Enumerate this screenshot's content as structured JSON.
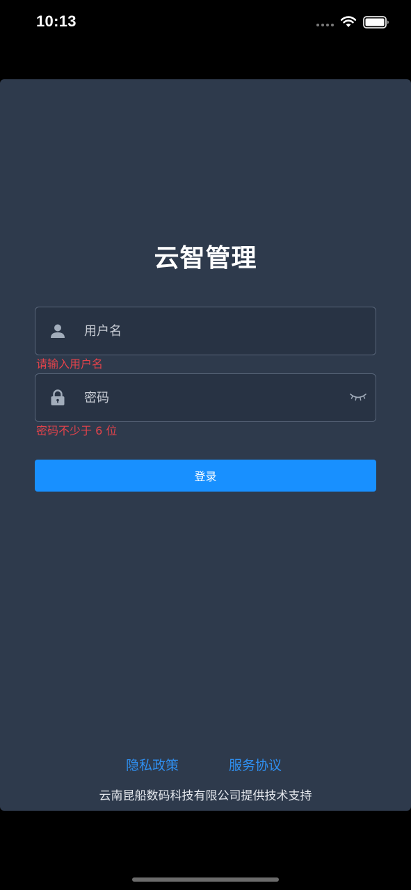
{
  "status_bar": {
    "time": "10:13"
  },
  "app": {
    "title": "云智管理"
  },
  "login_form": {
    "username": {
      "placeholder": "用户名",
      "value": "",
      "error": "请输入用户名",
      "icon": "user-icon"
    },
    "password": {
      "placeholder": "密码",
      "value": "",
      "error": "密码不少于 6 位",
      "icon": "lock-icon",
      "toggle_icon": "eye-closed-icon"
    },
    "submit_label": "登录"
  },
  "footer": {
    "privacy_link": "隐私政策",
    "terms_link": "服务协议",
    "credit": "云南昆船数码科技有限公司提供技术支持"
  },
  "colors": {
    "card_background": "#2e3a4c",
    "primary": "#1890ff",
    "error": "#e2434b",
    "link": "#2f8ff0"
  }
}
